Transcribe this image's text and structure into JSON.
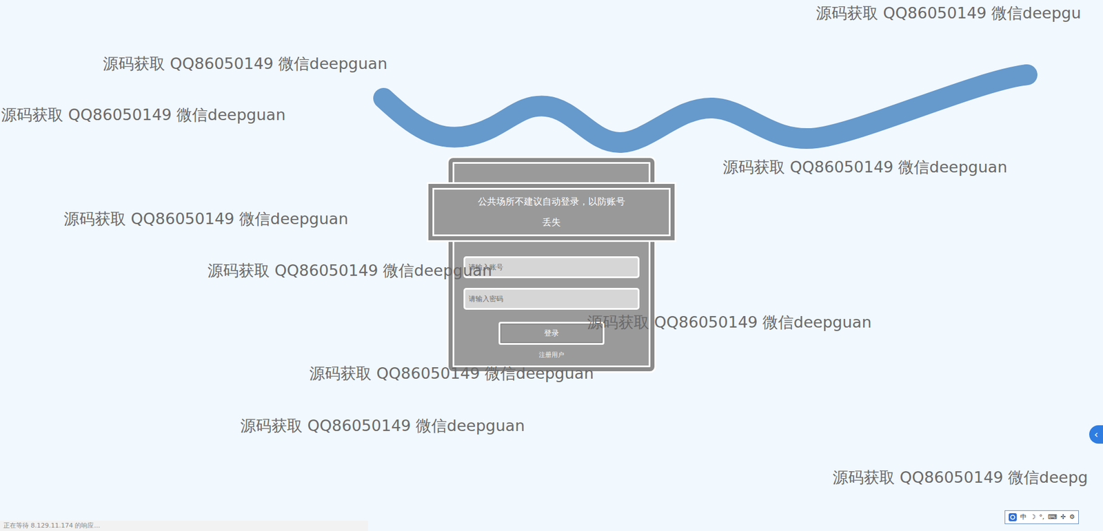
{
  "watermarks": [
    "源码获取 QQ86050149 微信deepgu",
    "源码获取 QQ86050149 微信deepguan",
    "源码获取 QQ86050149 微信deepguan",
    "源码获取 QQ86050149 微信deepguan",
    "源码获取 QQ86050149 微信deepguan",
    "源码获取 QQ86050149 微信deepguan",
    "源码获取 QQ86050149 微信deepguan",
    "源码获取 QQ86050149 微信deepguan",
    "源码获取 QQ86050149 微信deepguan",
    "源码获取 QQ86050149 微信deepg"
  ],
  "login": {
    "notice": "公共场所不建议自动登录，以防账号丢失",
    "account_placeholder": "请输入账号",
    "password_placeholder": "请输入密码",
    "login_button": "登录",
    "register_link": "注册用户"
  },
  "side_tab": {
    "icon": "‹"
  },
  "ime_toolbar": {
    "items": [
      "中",
      "☽",
      "°,",
      "⌨",
      "✢",
      "⚙"
    ]
  },
  "status_bar": "正在等待 8.129.11.174 的响应..."
}
